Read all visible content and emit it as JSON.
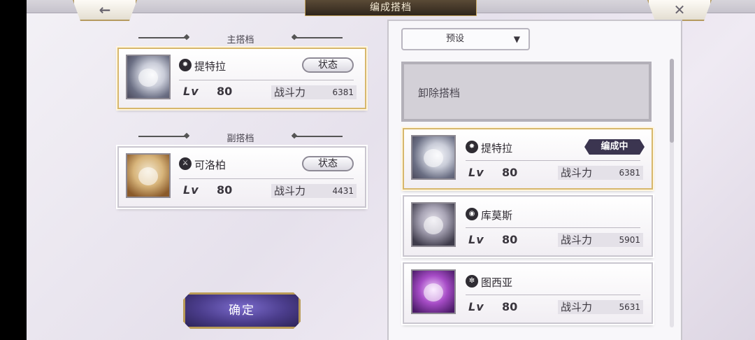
{
  "header": {
    "title": "编成搭档",
    "back_icon": "arrow-left-icon",
    "close_icon": "close-icon"
  },
  "main_partner": {
    "section_label": "主搭档",
    "name": "提特拉",
    "element_icon": "dark-element-icon",
    "status_label": "状态",
    "lv_label": "Lv",
    "level": "80",
    "power_label": "战斗力",
    "power": "6381"
  },
  "sub_partner": {
    "section_label": "副搭档",
    "name": "可洛柏",
    "element_icon": "sword-element-icon",
    "status_label": "状态",
    "lv_label": "Lv",
    "level": "80",
    "power_label": "战斗力",
    "power": "4431"
  },
  "confirm_label": "确定",
  "right_panel": {
    "preset_label": "预设",
    "unequip_label": "卸除搭档",
    "list": [
      {
        "name": "提特拉",
        "element_icon": "dark-element-icon",
        "lv_label": "Lv",
        "level": "80",
        "power_label": "战斗力",
        "power": "6381",
        "badge": "编成中",
        "selected": true
      },
      {
        "name": "库莫斯",
        "element_icon": "eye-element-icon",
        "lv_label": "Lv",
        "level": "80",
        "power_label": "战斗力",
        "power": "5901"
      },
      {
        "name": "图西亚",
        "element_icon": "swirl-element-icon",
        "lv_label": "Lv",
        "level": "80",
        "power_label": "战斗力",
        "power": "5631"
      }
    ]
  },
  "colors": {
    "accent_gold": "#d7b76c",
    "badge_bg": "#3b3550",
    "confirm_bg": "#4b3d8c"
  }
}
